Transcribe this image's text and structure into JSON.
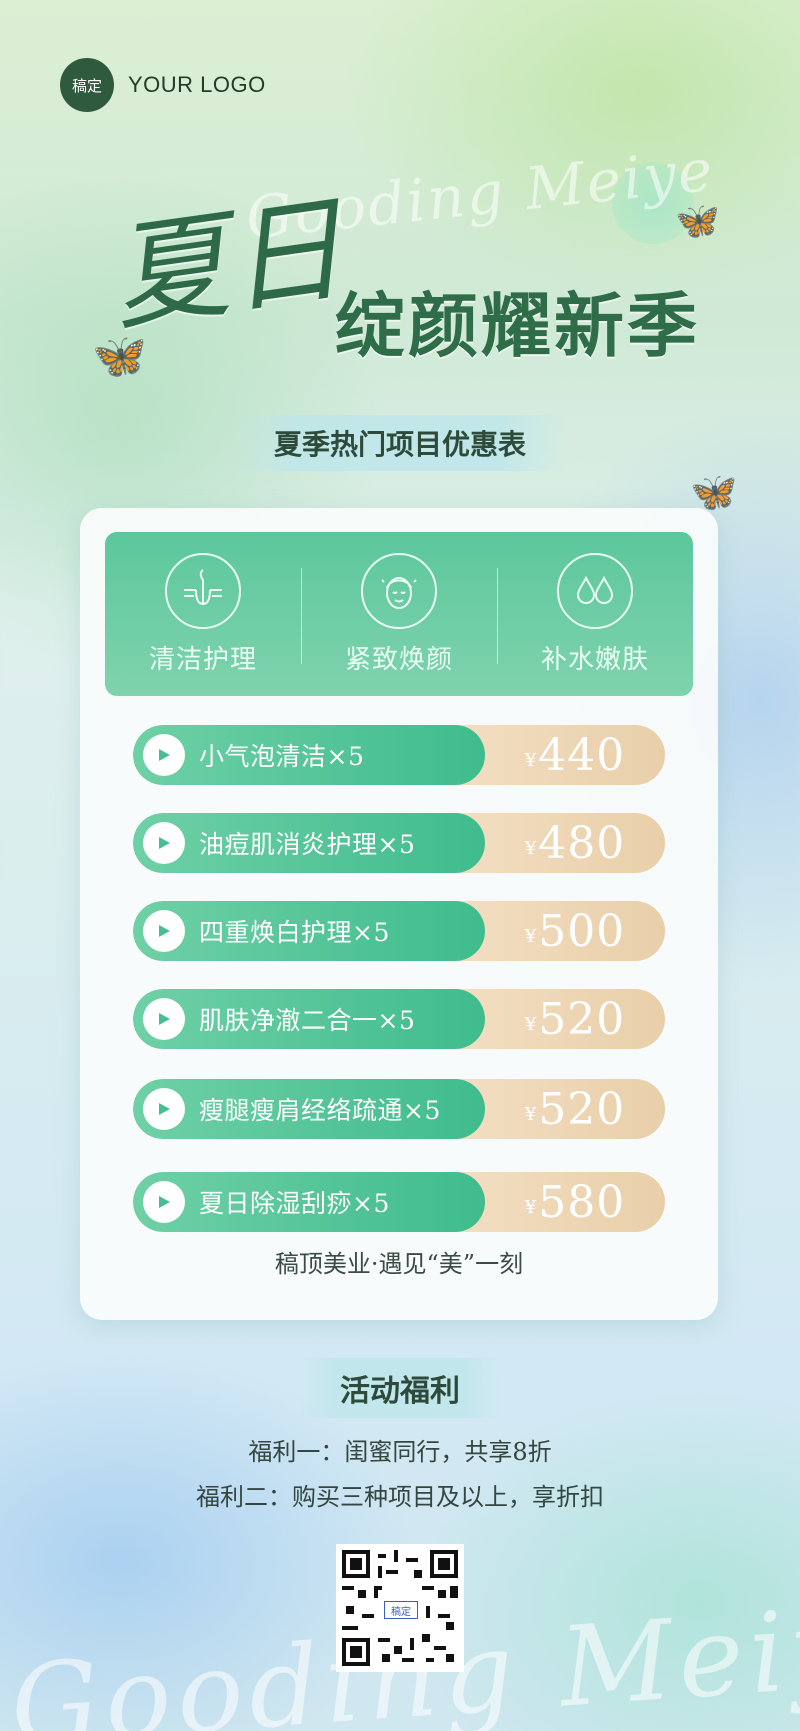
{
  "brand": {
    "logo_badge": "稿定",
    "logo_text": "YOUR LOGO",
    "script_text": "Gooding Meiye"
  },
  "hero": {
    "title_main": "夏日",
    "title_sub": "绽颜耀新季",
    "subtitle": "夏季热门项目优惠表"
  },
  "categories": [
    {
      "label": "清洁护理",
      "icon": "hair-follicle-icon"
    },
    {
      "label": "紧致焕颜",
      "icon": "face-icon"
    },
    {
      "label": "补水嫩肤",
      "icon": "water-drop-icon"
    }
  ],
  "price_list": [
    {
      "name": "小气泡清洁×5",
      "currency": "¥",
      "price": "440"
    },
    {
      "name": "油痘肌消炎护理×5",
      "currency": "¥",
      "price": "480"
    },
    {
      "name": "四重焕白护理×5",
      "currency": "¥",
      "price": "500"
    },
    {
      "name": "肌肤净澈二合一×5",
      "currency": "¥",
      "price": "520"
    },
    {
      "name": "瘦腿瘦肩经络疏通×5",
      "currency": "¥",
      "price": "520"
    },
    {
      "name": "夏日除湿刮痧×5",
      "currency": "¥",
      "price": "580"
    }
  ],
  "tagline": "稿顶美业·遇见“美”一刻",
  "benefits": {
    "title": "活动福利",
    "items": [
      "福利一：闺蜜同行，共享8折",
      "福利二：购买三种项目及以上，享折扣"
    ]
  },
  "qr": {
    "badge": "稿定"
  },
  "colors": {
    "accent_green": "#3fbc8d",
    "dark_green": "#2f5a3d",
    "price_gold": "#e9cfa9"
  }
}
